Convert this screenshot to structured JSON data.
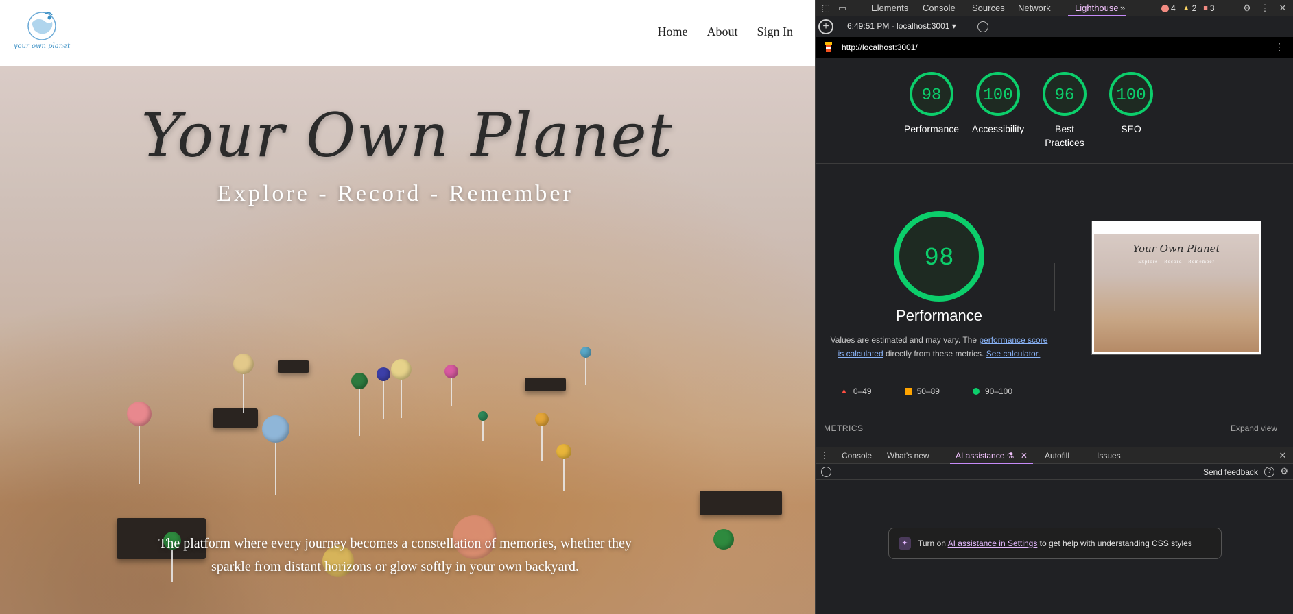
{
  "site": {
    "logo_text": "your own planet",
    "nav": [
      "Home",
      "About",
      "Sign In"
    ],
    "hero": {
      "title": "Your Own Planet",
      "subtitle": "Explore - Record - Remember",
      "description": "The platform where every journey becomes a constellation of memories, whether they sparkle from distant horizons or glow softly in your own backyard."
    }
  },
  "devtools": {
    "tabs": [
      "Elements",
      "Console",
      "Sources",
      "Network",
      "Lighthouse"
    ],
    "active_tab": "Lighthouse",
    "more_tabs": "»",
    "badges": {
      "errors": "4",
      "warnings": "2",
      "messages": "3"
    },
    "report_label": "6:49:51 PM - localhost:3001",
    "url": "http://localhost:3001/",
    "scores": [
      {
        "label": "Performance",
        "value": 98
      },
      {
        "label": "Accessibility",
        "value": 100
      },
      {
        "label": "Best Practices",
        "value": 96
      },
      {
        "label": "SEO",
        "value": 100
      }
    ],
    "performance": {
      "score": 98,
      "label": "Performance",
      "note_prefix": "Values are estimated and may vary. The ",
      "note_link1": "performance score is calculated",
      "note_middle": " directly from these metrics. ",
      "note_link2": "See calculator."
    },
    "legend": [
      {
        "range": "0–49",
        "color": "#ff4e42"
      },
      {
        "range": "50–89",
        "color": "#ffa400"
      },
      {
        "range": "90–100",
        "color": "#0cce6b"
      }
    ],
    "thumbnail": {
      "title": "Your Own Planet",
      "subtitle": "Explore - Record - Remember"
    },
    "metrics_label": "METRICS",
    "expand_view": "Expand view",
    "drawer": {
      "tabs": [
        "Console",
        "What's new",
        "AI assistance",
        "Autofill",
        "Issues"
      ],
      "active_tab": "AI assistance",
      "send_feedback": "Send feedback",
      "banner_prefix": "Turn on ",
      "banner_link": "AI assistance in Settings",
      "banner_suffix": " to get help with understanding CSS styles"
    },
    "colors": {
      "pass": "#0cce6b",
      "accent": "#c58af9",
      "link": "#8ab4f8"
    }
  }
}
